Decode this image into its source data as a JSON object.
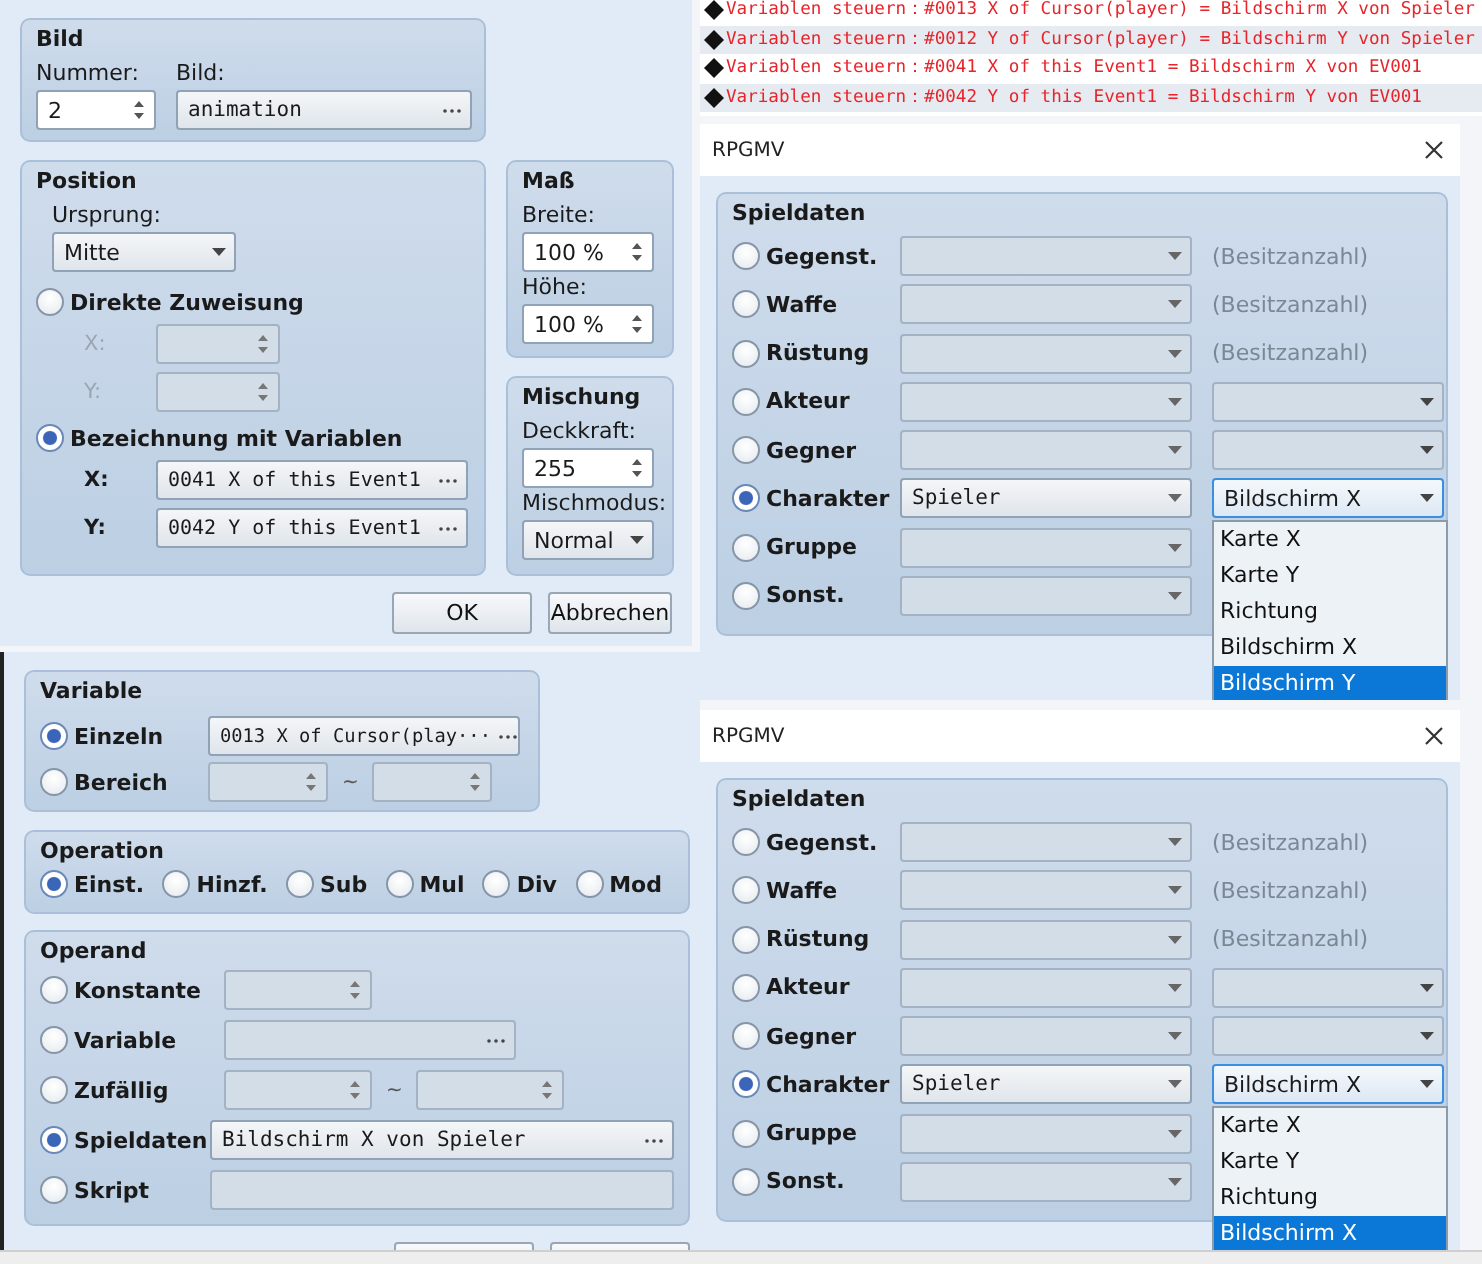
{
  "picture_dialog": {
    "image": {
      "title": "Bild",
      "number_label": "Nummer:",
      "number": "2",
      "image_label": "Bild:",
      "image": "animation"
    },
    "position": {
      "title": "Position",
      "origin_label": "Ursprung:",
      "origin": "Mitte",
      "modes": [
        {
          "label": "Direkte Zuweisung",
          "selected": false,
          "kind": "spin",
          "fields": [
            {
              "label": "X:"
            },
            {
              "label": "Y:"
            }
          ]
        },
        {
          "label": "Bezeichnung mit Variablen",
          "selected": true,
          "kind": "picker",
          "fields": [
            {
              "label": "X:",
              "value": "0041 X of this Event1"
            },
            {
              "label": "Y:",
              "value": "0042 Y of this Event1"
            }
          ]
        }
      ]
    },
    "scale": {
      "title": "Maß",
      "fields": [
        {
          "label": "Breite:",
          "value": "100 %"
        },
        {
          "label": "Höhe:",
          "value": "100 %"
        }
      ]
    },
    "blend": {
      "title": "Mischung",
      "opacity_label": "Deckkraft:",
      "opacity": "255",
      "mode_label": "Mischmodus:",
      "mode": "Normal"
    },
    "buttons": [
      "OK",
      "Abbrechen"
    ]
  },
  "event_commands": [
    "Variablen steuern：#0013 X of Cursor(player) = Bildschirm X von Spieler",
    "Variablen steuern：#0012 Y of Cursor(player) = Bildschirm Y von Spieler",
    "Variablen steuern：#0041 X of this Event1 = Bildschirm X von EV001",
    "Variablen steuern：#0042 Y of this Event1 = Bildschirm Y von EV001"
  ],
  "variable_dialog": {
    "variable": {
      "title": "Variable",
      "options": [
        {
          "label": "Einzeln",
          "selected": true,
          "kind": "picker",
          "value": "0013 X of Cursor(play···"
        },
        {
          "label": "Bereich",
          "selected": false,
          "kind": "range",
          "separator": "~"
        }
      ]
    },
    "operation": {
      "title": "Operation",
      "options": [
        {
          "label": "Einst.",
          "selected": true
        },
        {
          "label": "Hinzf.",
          "selected": false
        },
        {
          "label": "Sub",
          "selected": false
        },
        {
          "label": "Mul",
          "selected": false
        },
        {
          "label": "Div",
          "selected": false
        },
        {
          "label": "Mod",
          "selected": false
        }
      ]
    },
    "operand": {
      "title": "Operand",
      "options": [
        {
          "label": "Konstante",
          "selected": false,
          "kind": "spin"
        },
        {
          "label": "Variable",
          "selected": false,
          "kind": "picker"
        },
        {
          "label": "Zufällig",
          "selected": false,
          "kind": "range",
          "separator": "~"
        },
        {
          "label": "Spieldaten",
          "selected": true,
          "kind": "picker",
          "value": "Bildschirm X von Spieler"
        },
        {
          "label": "Skript",
          "selected": false,
          "kind": "text"
        }
      ]
    }
  },
  "game_data_dialogs": [
    {
      "title": "RPGMV",
      "group_title": "Spieldaten",
      "rows": [
        {
          "label": "Gegenst.",
          "selected": false,
          "kind": "count",
          "note": "(Besitzanzahl)"
        },
        {
          "label": "Waffe",
          "selected": false,
          "kind": "count",
          "note": "(Besitzanzahl)"
        },
        {
          "label": "Rüstung",
          "selected": false,
          "kind": "count",
          "note": "(Besitzanzahl)"
        },
        {
          "label": "Akteur",
          "selected": false,
          "kind": "pair",
          "open": false
        },
        {
          "label": "Gegner",
          "selected": false,
          "kind": "pair",
          "open": false
        },
        {
          "label": "Charakter",
          "selected": true,
          "kind": "pair",
          "open": true,
          "value": "Spieler",
          "second_value": "Bildschirm X"
        },
        {
          "label": "Gruppe",
          "selected": false,
          "kind": "single"
        },
        {
          "label": "Sonst.",
          "selected": false,
          "kind": "single"
        }
      ],
      "list": [
        {
          "label": "Karte X",
          "selected": false
        },
        {
          "label": "Karte Y",
          "selected": false
        },
        {
          "label": "Richtung",
          "selected": false
        },
        {
          "label": "Bildschirm X",
          "selected": false
        },
        {
          "label": "Bildschirm Y",
          "selected": true
        }
      ]
    },
    {
      "title": "RPGMV",
      "group_title": "Spieldaten",
      "rows": [
        {
          "label": "Gegenst.",
          "selected": false,
          "kind": "count",
          "note": "(Besitzanzahl)"
        },
        {
          "label": "Waffe",
          "selected": false,
          "kind": "count",
          "note": "(Besitzanzahl)"
        },
        {
          "label": "Rüstung",
          "selected": false,
          "kind": "count",
          "note": "(Besitzanzahl)"
        },
        {
          "label": "Akteur",
          "selected": false,
          "kind": "pair",
          "open": false
        },
        {
          "label": "Gegner",
          "selected": false,
          "kind": "pair",
          "open": false
        },
        {
          "label": "Charakter",
          "selected": true,
          "kind": "pair",
          "open": true,
          "value": "Spieler",
          "second_value": "Bildschirm X"
        },
        {
          "label": "Gruppe",
          "selected": false,
          "kind": "single"
        },
        {
          "label": "Sonst.",
          "selected": false,
          "kind": "single"
        }
      ],
      "list": [
        {
          "label": "Karte X",
          "selected": false
        },
        {
          "label": "Karte Y",
          "selected": false
        },
        {
          "label": "Richtung",
          "selected": false
        },
        {
          "label": "Bildschirm X",
          "selected": true
        }
      ]
    }
  ]
}
